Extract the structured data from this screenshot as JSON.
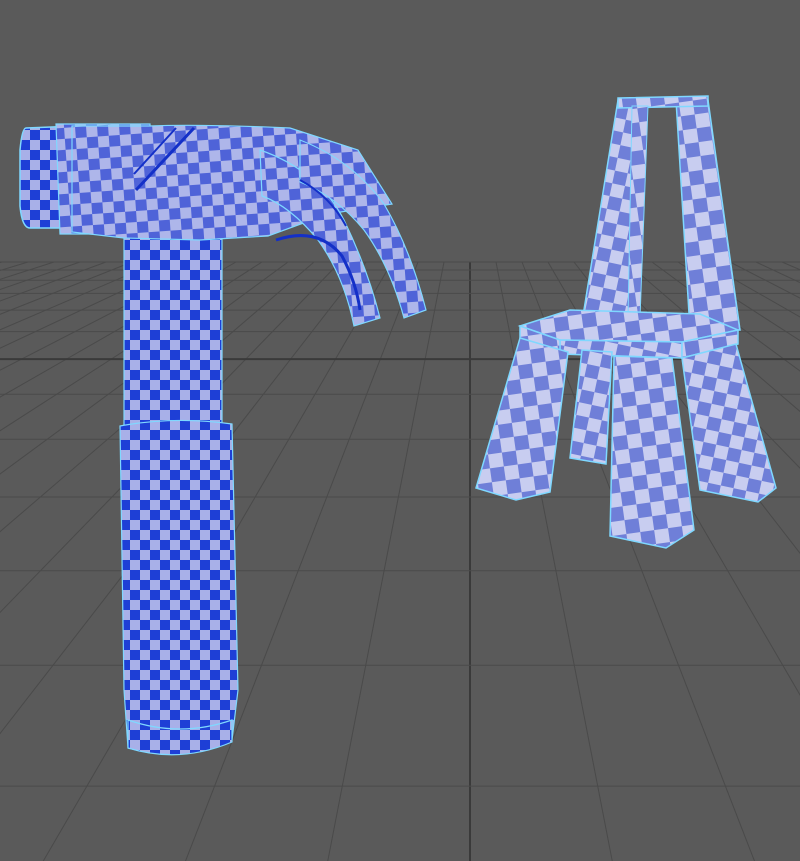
{
  "viewport": {
    "background_color": "#5a5a5a",
    "grid_color": "#4a4a4a",
    "grid_axis_color": "#3a3a3a",
    "grid_visible": true
  },
  "checker": {
    "dark_color": "#1e3fd6",
    "light_color": "#a8b0e8",
    "wire_color": "#7fd8ff"
  },
  "scene_objects": [
    {
      "name": "hammer",
      "material": "uv-checker",
      "selected": true,
      "icon": "hammer-icon"
    },
    {
      "name": "chair",
      "material": "uv-checker",
      "selected": true,
      "icon": "chair-icon"
    }
  ]
}
